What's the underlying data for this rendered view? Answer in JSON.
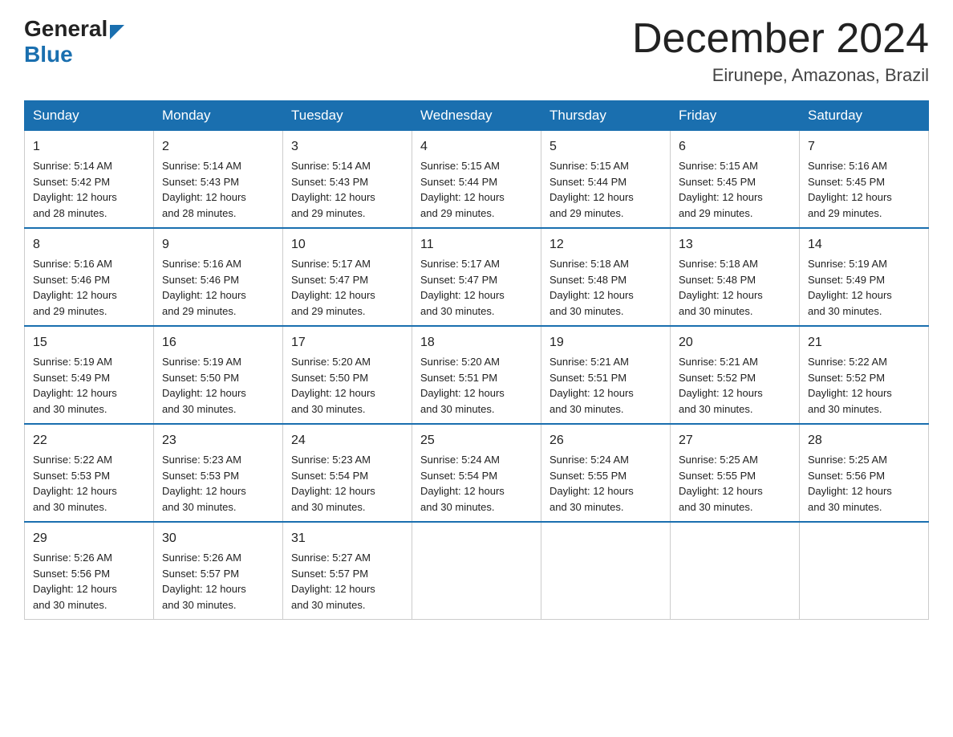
{
  "header": {
    "logo_general": "General",
    "logo_blue": "Blue",
    "month_title": "December 2024",
    "location": "Eirunepe, Amazonas, Brazil"
  },
  "days_of_week": [
    "Sunday",
    "Monday",
    "Tuesday",
    "Wednesday",
    "Thursday",
    "Friday",
    "Saturday"
  ],
  "weeks": [
    [
      {
        "num": "1",
        "sunrise": "5:14 AM",
        "sunset": "5:42 PM",
        "daylight": "12 hours and 28 minutes."
      },
      {
        "num": "2",
        "sunrise": "5:14 AM",
        "sunset": "5:43 PM",
        "daylight": "12 hours and 28 minutes."
      },
      {
        "num": "3",
        "sunrise": "5:14 AM",
        "sunset": "5:43 PM",
        "daylight": "12 hours and 29 minutes."
      },
      {
        "num": "4",
        "sunrise": "5:15 AM",
        "sunset": "5:44 PM",
        "daylight": "12 hours and 29 minutes."
      },
      {
        "num": "5",
        "sunrise": "5:15 AM",
        "sunset": "5:44 PM",
        "daylight": "12 hours and 29 minutes."
      },
      {
        "num": "6",
        "sunrise": "5:15 AM",
        "sunset": "5:45 PM",
        "daylight": "12 hours and 29 minutes."
      },
      {
        "num": "7",
        "sunrise": "5:16 AM",
        "sunset": "5:45 PM",
        "daylight": "12 hours and 29 minutes."
      }
    ],
    [
      {
        "num": "8",
        "sunrise": "5:16 AM",
        "sunset": "5:46 PM",
        "daylight": "12 hours and 29 minutes."
      },
      {
        "num": "9",
        "sunrise": "5:16 AM",
        "sunset": "5:46 PM",
        "daylight": "12 hours and 29 minutes."
      },
      {
        "num": "10",
        "sunrise": "5:17 AM",
        "sunset": "5:47 PM",
        "daylight": "12 hours and 29 minutes."
      },
      {
        "num": "11",
        "sunrise": "5:17 AM",
        "sunset": "5:47 PM",
        "daylight": "12 hours and 30 minutes."
      },
      {
        "num": "12",
        "sunrise": "5:18 AM",
        "sunset": "5:48 PM",
        "daylight": "12 hours and 30 minutes."
      },
      {
        "num": "13",
        "sunrise": "5:18 AM",
        "sunset": "5:48 PM",
        "daylight": "12 hours and 30 minutes."
      },
      {
        "num": "14",
        "sunrise": "5:19 AM",
        "sunset": "5:49 PM",
        "daylight": "12 hours and 30 minutes."
      }
    ],
    [
      {
        "num": "15",
        "sunrise": "5:19 AM",
        "sunset": "5:49 PM",
        "daylight": "12 hours and 30 minutes."
      },
      {
        "num": "16",
        "sunrise": "5:19 AM",
        "sunset": "5:50 PM",
        "daylight": "12 hours and 30 minutes."
      },
      {
        "num": "17",
        "sunrise": "5:20 AM",
        "sunset": "5:50 PM",
        "daylight": "12 hours and 30 minutes."
      },
      {
        "num": "18",
        "sunrise": "5:20 AM",
        "sunset": "5:51 PM",
        "daylight": "12 hours and 30 minutes."
      },
      {
        "num": "19",
        "sunrise": "5:21 AM",
        "sunset": "5:51 PM",
        "daylight": "12 hours and 30 minutes."
      },
      {
        "num": "20",
        "sunrise": "5:21 AM",
        "sunset": "5:52 PM",
        "daylight": "12 hours and 30 minutes."
      },
      {
        "num": "21",
        "sunrise": "5:22 AM",
        "sunset": "5:52 PM",
        "daylight": "12 hours and 30 minutes."
      }
    ],
    [
      {
        "num": "22",
        "sunrise": "5:22 AM",
        "sunset": "5:53 PM",
        "daylight": "12 hours and 30 minutes."
      },
      {
        "num": "23",
        "sunrise": "5:23 AM",
        "sunset": "5:53 PM",
        "daylight": "12 hours and 30 minutes."
      },
      {
        "num": "24",
        "sunrise": "5:23 AM",
        "sunset": "5:54 PM",
        "daylight": "12 hours and 30 minutes."
      },
      {
        "num": "25",
        "sunrise": "5:24 AM",
        "sunset": "5:54 PM",
        "daylight": "12 hours and 30 minutes."
      },
      {
        "num": "26",
        "sunrise": "5:24 AM",
        "sunset": "5:55 PM",
        "daylight": "12 hours and 30 minutes."
      },
      {
        "num": "27",
        "sunrise": "5:25 AM",
        "sunset": "5:55 PM",
        "daylight": "12 hours and 30 minutes."
      },
      {
        "num": "28",
        "sunrise": "5:25 AM",
        "sunset": "5:56 PM",
        "daylight": "12 hours and 30 minutes."
      }
    ],
    [
      {
        "num": "29",
        "sunrise": "5:26 AM",
        "sunset": "5:56 PM",
        "daylight": "12 hours and 30 minutes."
      },
      {
        "num": "30",
        "sunrise": "5:26 AM",
        "sunset": "5:57 PM",
        "daylight": "12 hours and 30 minutes."
      },
      {
        "num": "31",
        "sunrise": "5:27 AM",
        "sunset": "5:57 PM",
        "daylight": "12 hours and 30 minutes."
      },
      null,
      null,
      null,
      null
    ]
  ],
  "labels": {
    "sunrise": "Sunrise:",
    "sunset": "Sunset:",
    "daylight": "Daylight:"
  }
}
